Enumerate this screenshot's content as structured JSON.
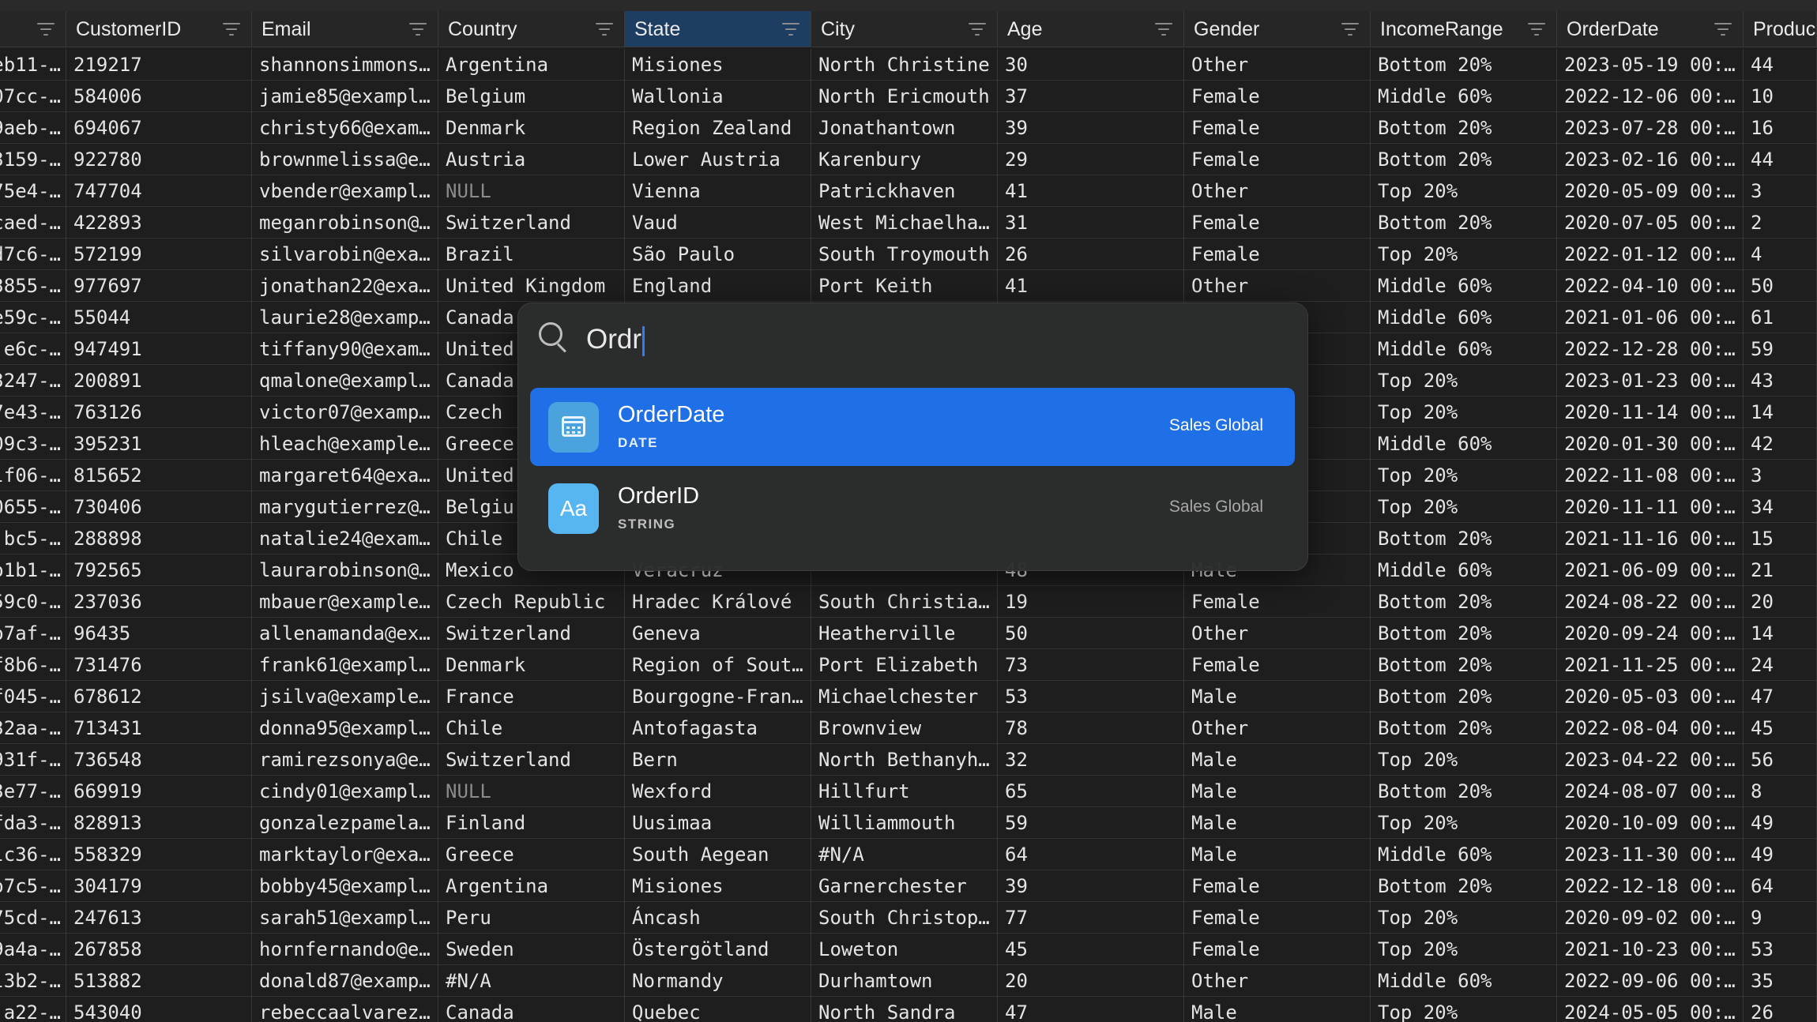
{
  "columns": [
    {
      "label": ""
    },
    {
      "label": "CustomerID"
    },
    {
      "label": "Email"
    },
    {
      "label": "Country"
    },
    {
      "label": "State",
      "selected": true
    },
    {
      "label": "City"
    },
    {
      "label": "Age"
    },
    {
      "label": "Gender"
    },
    {
      "label": "IncomeRange"
    },
    {
      "label": "OrderDate"
    },
    {
      "label": "Produc"
    }
  ],
  "rows": [
    [
      "eb11-…",
      "219217",
      "shannonsimmons…",
      "Argentina",
      "Misiones",
      "North Christine",
      "30",
      "Other",
      "Bottom 20%",
      "2023-05-19 00:…",
      "44"
    ],
    [
      "07cc-…",
      "584006",
      "jamie85@exampl…",
      "Belgium",
      "Wallonia",
      "North Ericmouth",
      "37",
      "Female",
      "Middle 60%",
      "2022-12-06 00:…",
      "10"
    ],
    [
      "9aeb-…",
      "694067",
      "christy66@exam…",
      "Denmark",
      "Region Zealand",
      "Jonathantown",
      "39",
      "Female",
      "Bottom 20%",
      "2023-07-28 00:…",
      "16"
    ],
    [
      "3159-…",
      "922780",
      "brownmelissa@e…",
      "Austria",
      "Lower Austria",
      "Karenbury",
      "29",
      "Female",
      "Bottom 20%",
      "2023-02-16 00:…",
      "44"
    ],
    [
      "75e4-…",
      "747704",
      "vbender@exampl…",
      "NULL",
      "Vienna",
      "Patrickhaven",
      "41",
      "Other",
      "Top 20%",
      "2020-05-09 00:…",
      "3"
    ],
    [
      "caed-…",
      "422893",
      "meganrobinson@…",
      "Switzerland",
      "Vaud",
      "West Michaelha…",
      "31",
      "Female",
      "Bottom 20%",
      "2020-07-05 00:…",
      "2"
    ],
    [
      "d7c6-…",
      "572199",
      "silvarobin@exa…",
      "Brazil",
      "São Paulo",
      "South Troymouth",
      "26",
      "Female",
      "Top 20%",
      "2022-01-12 00:…",
      "4"
    ],
    [
      "3855-…",
      "977697",
      "jonathan22@exa…",
      "United Kingdom",
      "England",
      "Port Keith",
      "41",
      "Other",
      "Middle 60%",
      "2022-04-10 00:…",
      "50"
    ],
    [
      "e59c-…",
      "55044",
      "laurie28@examp…",
      "Canada",
      "",
      "",
      "",
      "",
      "Middle 60%",
      "2021-01-06 00:…",
      "61"
    ],
    [
      "e6c-…",
      "947491",
      "tiffany90@exam…",
      "United",
      "",
      "",
      "",
      "",
      "Middle 60%",
      "2022-12-28 00:…",
      "59"
    ],
    [
      "3247-…",
      "200891",
      "qmalone@exampl…",
      "Canada",
      "",
      "",
      "",
      "",
      "Top 20%",
      "2023-01-23 00:…",
      "43"
    ],
    [
      "7e43-…",
      "763126",
      "victor07@examp…",
      "Czech",
      "",
      "",
      "",
      "",
      "Top 20%",
      "2020-11-14 00:…",
      "14"
    ],
    [
      "09c3-…",
      "395231",
      "hleach@example…",
      "Greece",
      "",
      "",
      "",
      "",
      "Middle 60%",
      "2020-01-30 00:…",
      "42"
    ],
    [
      "lf06-…",
      "815652",
      "margaret64@exa…",
      "United",
      "",
      "",
      "",
      "",
      "Top 20%",
      "2022-11-08 00:…",
      "3"
    ],
    [
      "0655-…",
      "730406",
      "marygutierrez@…",
      "Belgiu",
      "",
      "",
      "",
      "",
      "Top 20%",
      "2020-11-11 00:…",
      "34"
    ],
    [
      "bc5-…",
      "288898",
      "natalie24@exam…",
      "Chile",
      "",
      "",
      "",
      "",
      "Bottom 20%",
      "2021-11-16 00:…",
      "15"
    ],
    [
      "o1b1-…",
      "792565",
      "laurarobinson@…",
      "Mexico",
      "Veracruz",
      "",
      "48",
      "Male",
      "Middle 60%",
      "2021-06-09 00:…",
      "21"
    ],
    [
      "59c0-…",
      "237036",
      "mbauer@example…",
      "Czech Republic",
      "Hradec Králové",
      "South Christia…",
      "19",
      "Female",
      "Bottom 20%",
      "2024-08-22 00:…",
      "20"
    ],
    [
      "o7af-…",
      "96435",
      "allenamanda@ex…",
      "Switzerland",
      "Geneva",
      "Heatherville",
      "50",
      "Other",
      "Bottom 20%",
      "2020-09-24 00:…",
      "14"
    ],
    [
      "f8b6-…",
      "731476",
      "frank61@exampl…",
      "Denmark",
      "Region of Sout…",
      "Port Elizabeth",
      "73",
      "Female",
      "Bottom 20%",
      "2021-11-25 00:…",
      "24"
    ],
    [
      "f045-…",
      "678612",
      "jsilva@example…",
      "France",
      "Bourgogne-Fran…",
      "Michaelchester",
      "53",
      "Male",
      "Bottom 20%",
      "2020-05-03 00:…",
      "47"
    ],
    [
      "32aa-…",
      "713431",
      "donna95@exampl…",
      "Chile",
      "Antofagasta",
      "Brownview",
      "78",
      "Other",
      "Bottom 20%",
      "2022-08-04 00:…",
      "45"
    ],
    [
      "931f-…",
      "736548",
      "ramirezsonya@e…",
      "Switzerland",
      "Bern",
      "North Bethanyh…",
      "32",
      "Male",
      "Top 20%",
      "2023-04-22 00:…",
      "56"
    ],
    [
      "3e77-…",
      "669919",
      "cindy01@exampl…",
      "NULL",
      "Wexford",
      "Hillfurt",
      "65",
      "Male",
      "Bottom 20%",
      "2024-08-07 00:…",
      "8"
    ],
    [
      "fda3-…",
      "828913",
      "gonzalezpamela…",
      "Finland",
      "Uusimaa",
      "Williammouth",
      "59",
      "Male",
      "Top 20%",
      "2020-10-09 00:…",
      "49"
    ],
    [
      "lc36-…",
      "558329",
      "marktaylor@exa…",
      "Greece",
      "South Aegean",
      "#N/A",
      "64",
      "Male",
      "Middle 60%",
      "2023-11-30 00:…",
      "49"
    ],
    [
      "o7c5-…",
      "304179",
      "bobby45@exampl…",
      "Argentina",
      "Misiones",
      "Garnerchester",
      "39",
      "Female",
      "Bottom 20%",
      "2022-12-18 00:…",
      "64"
    ],
    [
      "75cd-…",
      "247613",
      "sarah51@exampl…",
      "Peru",
      "Áncash",
      "South Christop…",
      "77",
      "Female",
      "Top 20%",
      "2020-09-02 00:…",
      "9"
    ],
    [
      "9a4a-…",
      "267858",
      "hornfernando@e…",
      "Sweden",
      "Östergötland",
      "Loweton",
      "45",
      "Female",
      "Top 20%",
      "2021-10-23 00:…",
      "53"
    ],
    [
      "l3b2-…",
      "513882",
      "donald87@examp…",
      "#N/A",
      "Normandy",
      "Durhamtown",
      "20",
      "Other",
      "Middle 60%",
      "2022-09-06 00:…",
      "35"
    ],
    [
      "a22-…",
      "543040",
      "rebeccaalvarez…",
      "Canada",
      "Quebec",
      "North Sandra",
      "47",
      "Male",
      "Top 20%",
      "2024-05-05 00:…",
      "26"
    ]
  ],
  "palette": {
    "query": "Ordr",
    "suggestions": [
      {
        "name": "OrderDate",
        "type": "DATE",
        "source": "Sales Global",
        "icon": "calendar-icon",
        "active": true
      },
      {
        "name": "OrderID",
        "type": "STRING",
        "source": "Sales Global",
        "icon": "text-type-icon",
        "icon_text": "Aa",
        "active": false
      }
    ]
  },
  "colors": {
    "accent": "#1f6fe6",
    "selected_header": "#1d3d63",
    "background": "#1e1e1e"
  }
}
